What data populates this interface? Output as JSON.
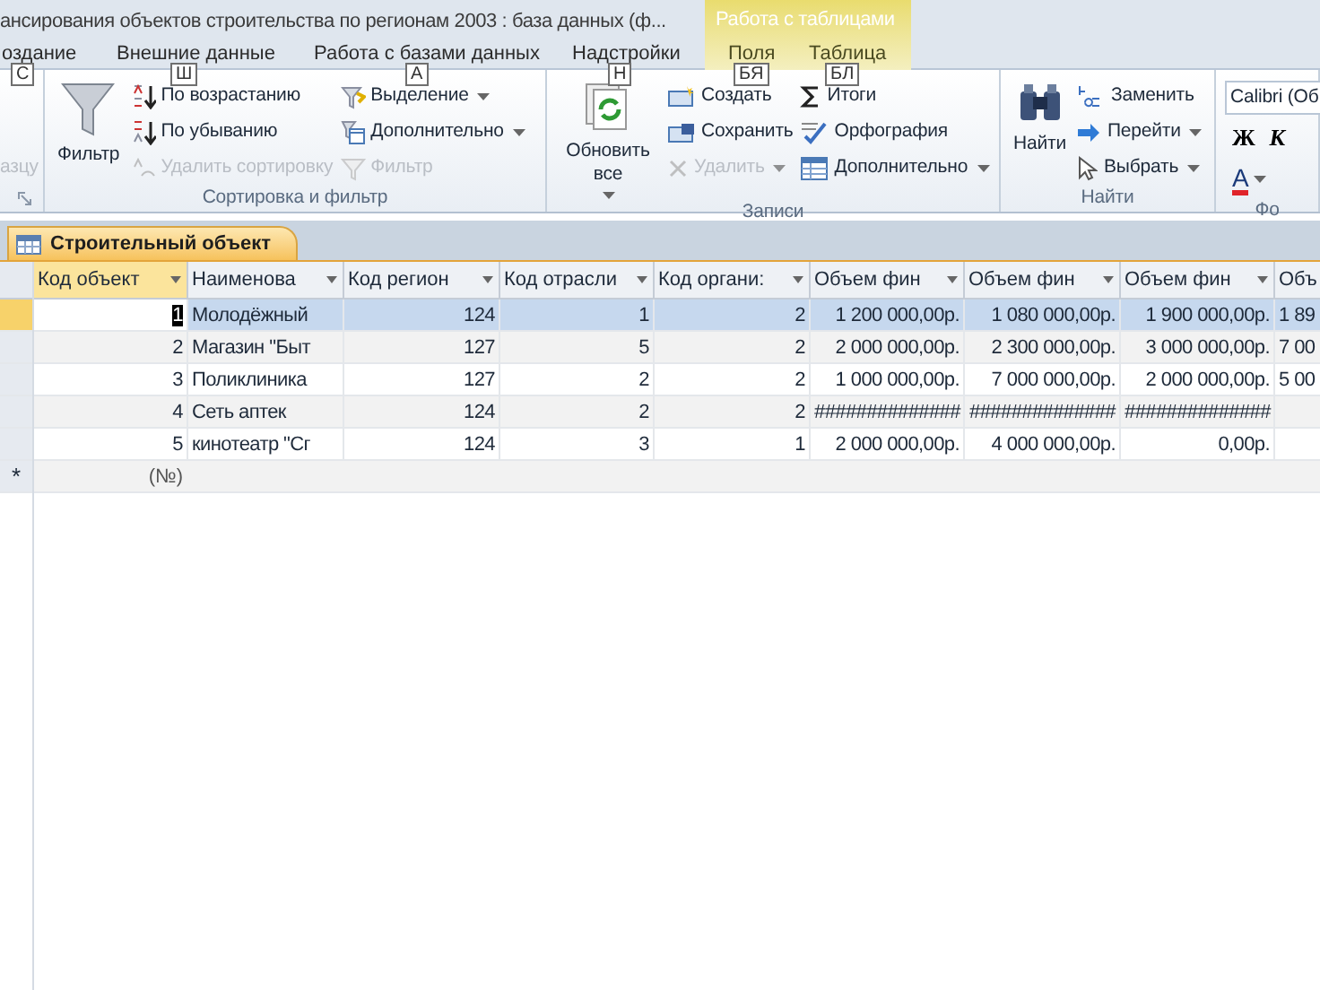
{
  "window": {
    "title": "ансирования объектов строительства по регионам 2003 : база данных (ф..."
  },
  "ribbon_tabs": [
    {
      "label": "оздание",
      "keytip": "С",
      "selected": false,
      "contextual": false
    },
    {
      "label": "Внешние данные",
      "keytip": "Ш",
      "selected": false,
      "contextual": false
    },
    {
      "label": "Работа с базами данных",
      "keytip": "А",
      "selected": false,
      "contextual": false
    },
    {
      "label": "Надстройки",
      "keytip": "Н",
      "selected": false,
      "contextual": false
    },
    {
      "label": "Поля",
      "keytip": "БЯ",
      "selected": false,
      "contextual": true
    },
    {
      "label": "Таблица",
      "keytip": "БЛ",
      "selected": false,
      "contextual": true
    }
  ],
  "contextual_group": {
    "title": "Работа с таблицами"
  },
  "ribbon_groups": [
    {
      "columns": [
        [
          {
            "kind": "small",
            "text": "азцу",
            "disabled": true,
            "dropdown": false
          }
        ]
      ],
      "launcher": true
    },
    {
      "label": "Сортировка и фильтр",
      "launcher": false,
      "columns": [
        [
          {
            "kind": "large",
            "text": "Фильтр",
            "disabled": false,
            "dropdown": false
          }
        ],
        [
          {
            "kind": "small",
            "text": "По возрастанию",
            "disabled": false,
            "dropdown": false
          },
          {
            "kind": "small",
            "text": "По убыванию",
            "disabled": false,
            "dropdown": false
          },
          {
            "kind": "small",
            "text": "Удалить сортировку",
            "disabled": true,
            "dropdown": false
          }
        ],
        [
          {
            "kind": "small",
            "text": "Выделение",
            "disabled": false,
            "dropdown": true
          },
          {
            "kind": "small",
            "text": "Дополнительно",
            "disabled": false,
            "dropdown": true
          },
          {
            "kind": "small",
            "text": "Фильтр",
            "disabled": true,
            "dropdown": false
          }
        ]
      ]
    },
    {
      "label": "Записи",
      "launcher": false,
      "columns": [
        [
          {
            "kind": "large",
            "text": "Обновить все",
            "disabled": false,
            "dropdown": true
          }
        ],
        [
          {
            "kind": "small",
            "text": "Создать",
            "disabled": false,
            "dropdown": false
          },
          {
            "kind": "small",
            "text": "Сохранить",
            "disabled": false,
            "dropdown": false
          },
          {
            "kind": "small",
            "text": "Удалить",
            "disabled": true,
            "dropdown": true
          }
        ],
        [
          {
            "kind": "small",
            "text": "Итоги",
            "disabled": false,
            "dropdown": false
          },
          {
            "kind": "small",
            "text": "Орфография",
            "disabled": false,
            "dropdown": false
          },
          {
            "kind": "small",
            "text": "Дополнительно",
            "disabled": false,
            "dropdown": true
          }
        ]
      ]
    },
    {
      "label": "Найти",
      "launcher": false,
      "columns": [
        [
          {
            "kind": "large",
            "text": "Найти",
            "disabled": false,
            "dropdown": false
          }
        ],
        [
          {
            "kind": "small",
            "text": "Заменить",
            "disabled": false,
            "dropdown": false
          },
          {
            "kind": "small",
            "text": "Перейти",
            "disabled": false,
            "dropdown": true
          },
          {
            "kind": "small",
            "text": "Выбрать",
            "disabled": false,
            "dropdown": true
          }
        ]
      ]
    },
    {
      "label": "Фо",
      "launcher": false,
      "columns": [
        [
          {
            "kind": "font-field",
            "text": "Calibri (Об"
          },
          {
            "kind": "format-buttons",
            "labels": [
              "Ж",
              "К"
            ]
          },
          {
            "kind": "color-button",
            "text": "A",
            "dropdown": true
          }
        ]
      ]
    }
  ],
  "document_tab": {
    "title": "Строительный объект"
  },
  "table": {
    "columns": [
      {
        "label": "Код объект",
        "selected": true
      },
      {
        "label": "Наименова",
        "selected": false
      },
      {
        "label": "Код регион",
        "selected": false
      },
      {
        "label": "Код отрасли",
        "selected": false
      },
      {
        "label": "Код органи:",
        "selected": false
      },
      {
        "label": "Объем фин",
        "selected": false
      },
      {
        "label": "Объем фин",
        "selected": false
      },
      {
        "label": "Объем фин",
        "selected": false
      },
      {
        "label": "Объ",
        "selected": false
      }
    ],
    "rows": [
      {
        "selected": true,
        "cells": [
          "1",
          "Молодёжный",
          "124",
          "1",
          "2",
          "1 200 000,00р.",
          "1 080 000,00р.",
          "1 900 000,00р.",
          "1 89"
        ]
      },
      {
        "selected": false,
        "cells": [
          "2",
          "Магазин \"Быт",
          "127",
          "5",
          "2",
          "2 000 000,00р.",
          "2 300 000,00р.",
          "3 000 000,00р.",
          "7 00"
        ]
      },
      {
        "selected": false,
        "cells": [
          "3",
          "Поликлиника",
          "127",
          "2",
          "2",
          "1 000 000,00р.",
          "7 000 000,00р.",
          "2 000 000,00р.",
          "5 00"
        ]
      },
      {
        "selected": false,
        "cells": [
          "4",
          "Сеть аптек",
          "124",
          "2",
          "2",
          "##############",
          "##############",
          "##############",
          ""
        ]
      },
      {
        "selected": false,
        "cells": [
          "5",
          "кинотеатр \"Сг",
          "124",
          "3",
          "1",
          "2 000 000,00р.",
          "4 000 000,00р.",
          "0,00р.",
          ""
        ]
      }
    ],
    "new_row": {
      "marker": "*",
      "placeholder": "(№)"
    }
  }
}
